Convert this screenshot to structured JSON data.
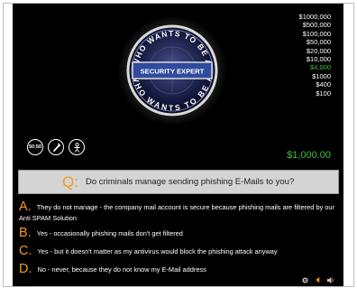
{
  "logo": {
    "arc_top": "WHO WANTS TO BE A",
    "arc_bottom": "WHO WANTS TO BE A",
    "banner": "SECURITY EXPERT"
  },
  "ladder": [
    "$1000,000",
    "$500,000",
    "$100,000",
    "$50,000",
    "$20,000",
    "$10,000",
    "$4,000",
    "$1000",
    "$400",
    "$100"
  ],
  "ladder_current_index": 6,
  "lifelines": [
    {
      "name": "fifty-fifty",
      "label": "50:50"
    },
    {
      "name": "phone-a-friend",
      "icon": "phone-icon"
    },
    {
      "name": "ask-the-audience",
      "icon": "person-icon"
    }
  ],
  "prize": "$1,000.00",
  "question": {
    "letter": "Q:",
    "text": "Do criminals manage sending phishing E-Mails to you?"
  },
  "answers": [
    {
      "letter": "A.",
      "text": "They do not manage - the company mail account is secure because phishing mails are filtered by our Anti SPAM Solution"
    },
    {
      "letter": "B.",
      "text": "Yes - occasionally phishing mails don't get filtered"
    },
    {
      "letter": "C.",
      "text": "Yes - but it doesn't matter as my antivirus would block the phishing attack anyway"
    },
    {
      "letter": "D.",
      "text": "No - never, because they do not know my E-Mail address"
    }
  ],
  "controls": [
    {
      "name": "settings",
      "icon": "gear-icon"
    },
    {
      "name": "previous",
      "icon": "arrow-left-icon"
    },
    {
      "name": "sound",
      "icon": "speaker-icon"
    }
  ],
  "colors": {
    "accent": "#f39a1e",
    "money_current": "#3fbf3f",
    "banner": "#2f4a9e",
    "background": "#000000"
  }
}
